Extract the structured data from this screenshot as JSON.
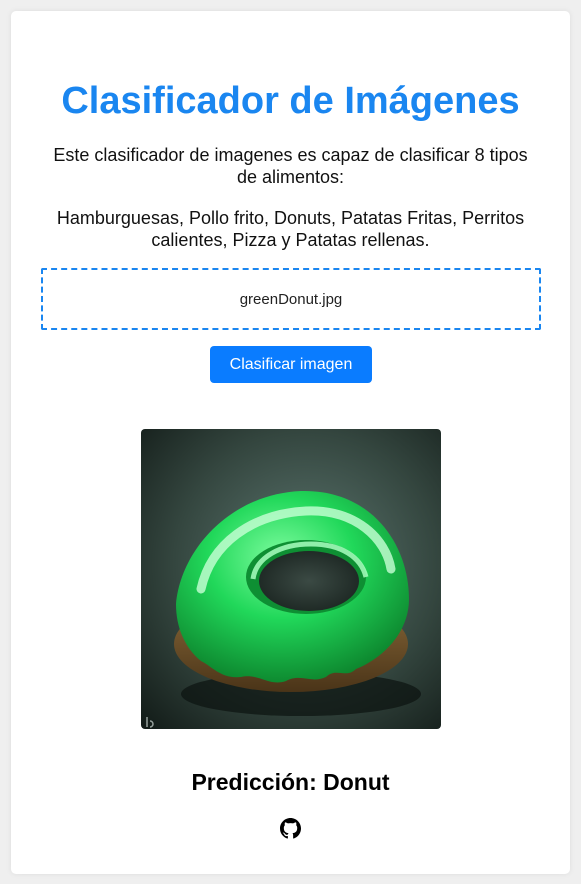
{
  "header": {
    "title": "Clasificador de Imágenes"
  },
  "intro": {
    "line1": "Este clasificador de imagenes es capaz de clasificar 8 tipos de alimentos:",
    "line2": "Hamburguesas, Pollo frito, Donuts, Patatas Fritas, Perritos calientes, Pizza y Patatas rellenas."
  },
  "upload": {
    "file_name": "greenDonut.jpg"
  },
  "actions": {
    "classify_label": "Clasificar imagen"
  },
  "result": {
    "prediction": "Predicción: Donut"
  },
  "footer": {
    "github_icon": "github-icon"
  },
  "colors": {
    "accent": "#1a86f0",
    "button": "#0a7cff",
    "page_bg": "#efefef",
    "card_bg": "#ffffff",
    "donut_icing": "#1fd65a"
  }
}
